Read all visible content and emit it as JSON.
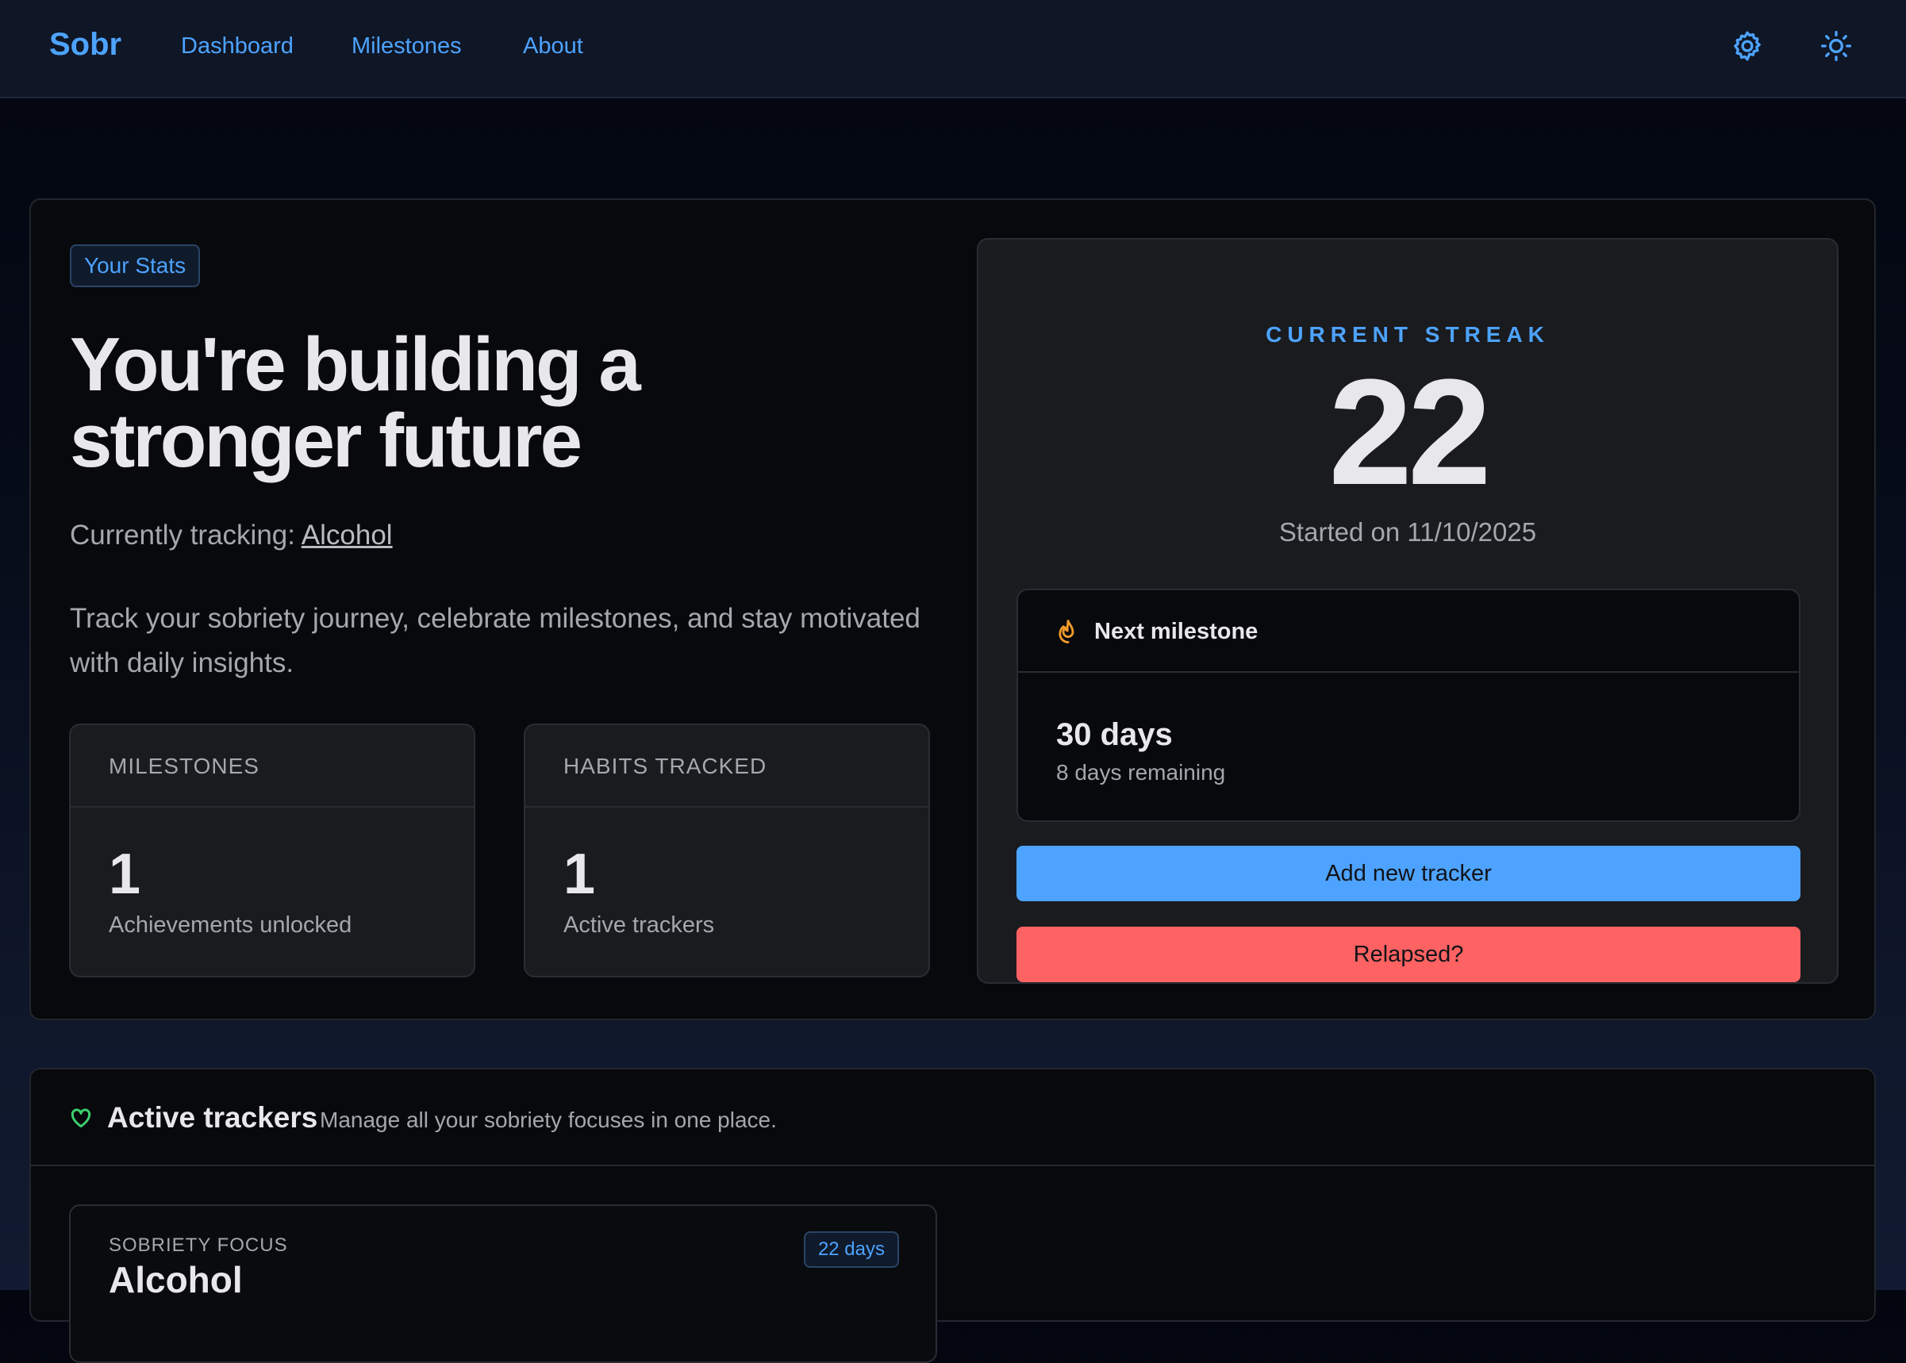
{
  "nav": {
    "brand": "Sobr",
    "links": [
      "Dashboard",
      "Milestones",
      "About"
    ],
    "icons": [
      "gear-icon",
      "sun-icon"
    ]
  },
  "hero": {
    "badge": "Your Stats",
    "title_line1": "You're building a",
    "title_line2": "stronger future",
    "tracking_prefix": "Currently tracking: ",
    "tracking_value": "Alcohol",
    "description": "Track your sobriety journey, celebrate milestones, and stay motivated with daily insights.",
    "stats": [
      {
        "label": "MILESTONES",
        "value": "1",
        "caption": "Achievements unlocked"
      },
      {
        "label": "HABITS TRACKED",
        "value": "1",
        "caption": "Active trackers"
      }
    ]
  },
  "streak": {
    "label": "CURRENT STREAK",
    "value": "22",
    "started": "Started on 11/10/2025",
    "next_milestone": {
      "title": "Next milestone",
      "days": "30 days",
      "remaining": "8 days remaining"
    },
    "add_button": "Add new tracker",
    "relapse_button": "Relapsed?"
  },
  "trackers": {
    "title": "Active trackers",
    "subtitle": "Manage all your sobriety focuses in one place.",
    "items": [
      {
        "focus_label": "SOBRIETY FOCUS",
        "name": "Alcohol",
        "badge": "22 days"
      }
    ]
  },
  "colors": {
    "accent": "#4da3ff",
    "danger": "#ff6262",
    "fire": "#f39a2b",
    "heart": "#3ccf6e"
  }
}
